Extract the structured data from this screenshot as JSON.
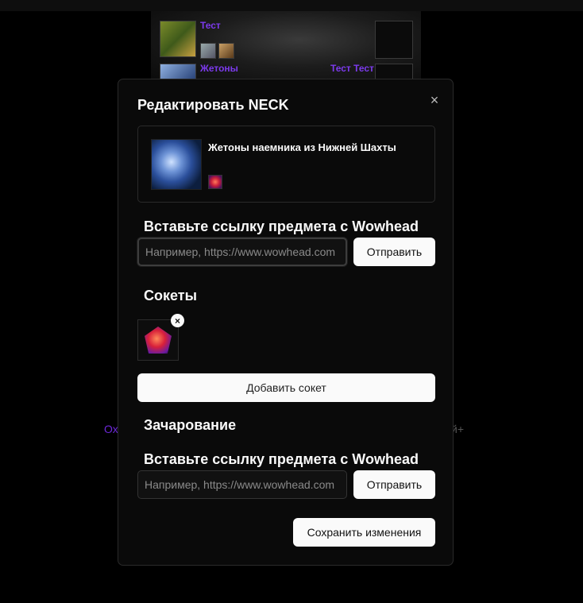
{
  "background": {
    "slot_label_1": "Тест",
    "slot_label_2": "Жетоны",
    "slot_label_3": "Тест Тест",
    "side_left": "Ох",
    "side_right": "й+"
  },
  "modal": {
    "title": "Редактировать NECK",
    "close_icon": "×",
    "item": {
      "name": "Жетоны наемника из Нижней Шахты",
      "icon": "neck-item-icon",
      "socket_icon": "red-gem-icon"
    },
    "item_link": {
      "title": "Вставьте ссылку предмета с Wowhead",
      "placeholder": "Например, https://www.wowhead.com",
      "value": "",
      "submit_label": "Отправить"
    },
    "sockets": {
      "title": "Сокеты",
      "items": [
        {
          "icon": "red-gem-icon",
          "remove_label": "×"
        }
      ],
      "add_label": "Добавить сокет"
    },
    "enchant": {
      "title": "Зачарование",
      "link_title": "Вставьте ссылку предмета с Wowhead",
      "placeholder": "Например, https://www.wowhead.com",
      "value": "",
      "submit_label": "Отправить"
    },
    "save_label": "Сохранить изменения"
  },
  "colors": {
    "background": "#000000",
    "modal_bg": "#0a0a0a",
    "button_bg": "#fafafa",
    "accent_purple": "#7c3aed"
  }
}
